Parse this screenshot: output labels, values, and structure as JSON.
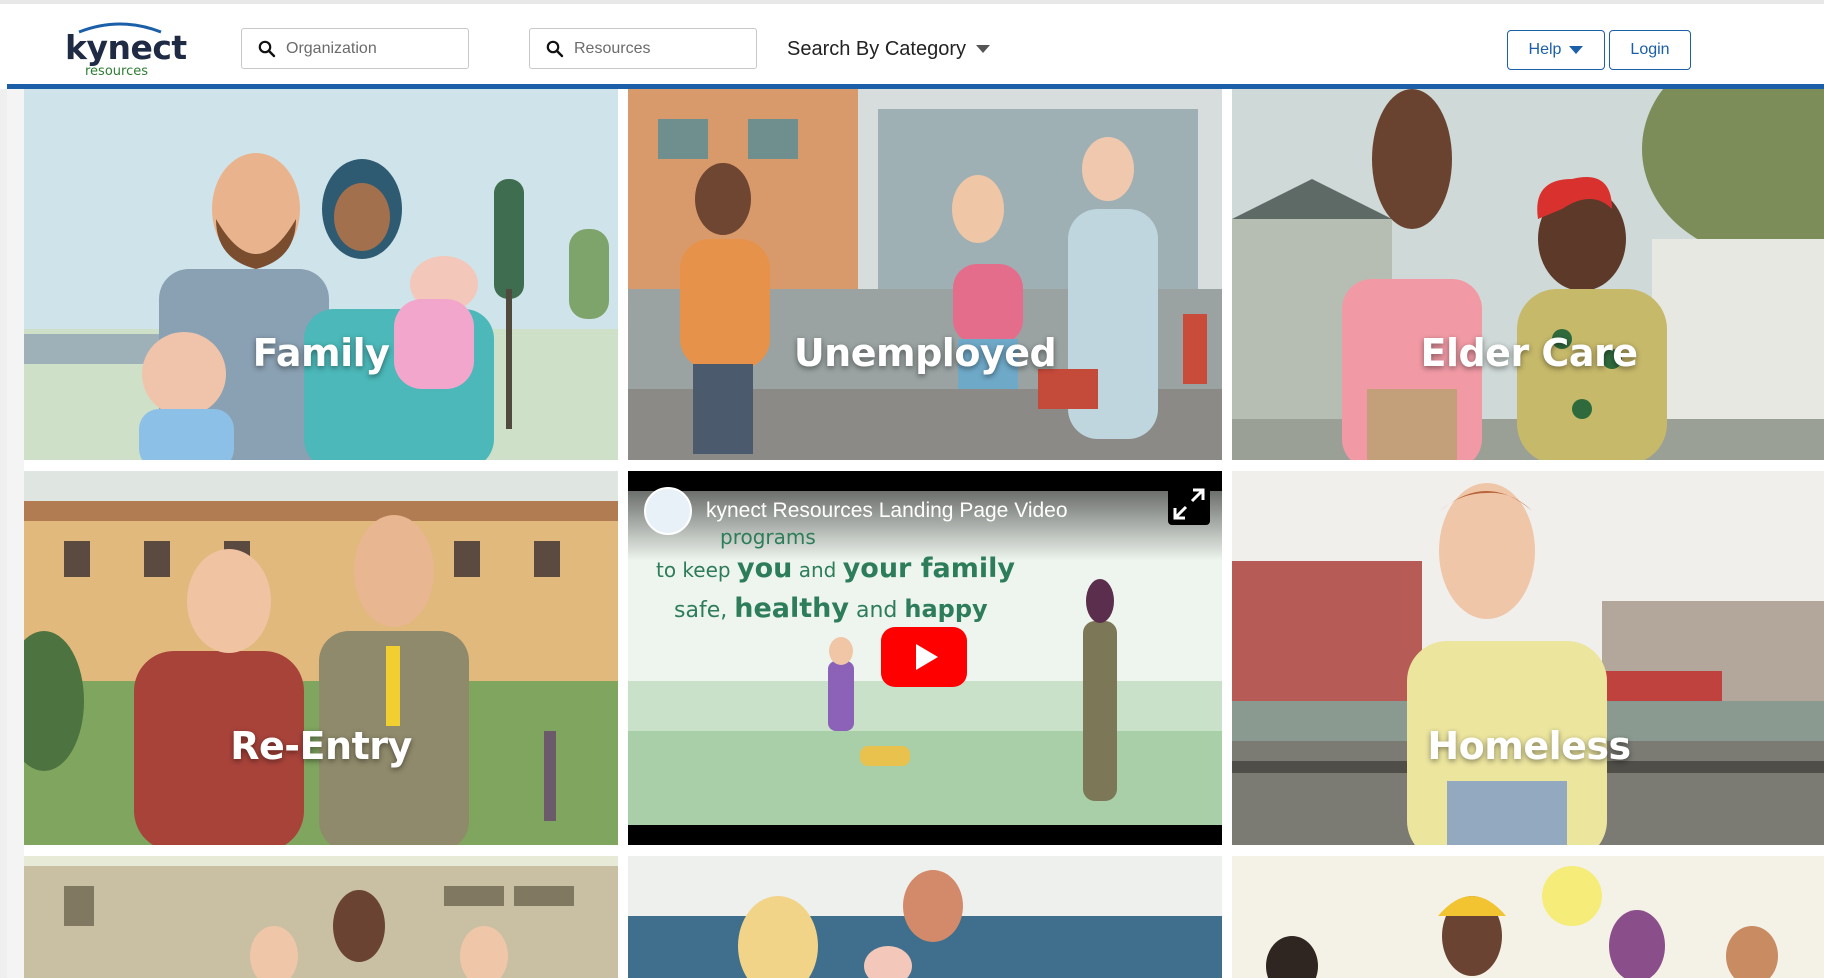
{
  "header": {
    "logo_word": "kynect",
    "logo_sub": "resources",
    "org_search_placeholder": "Organization",
    "res_search_placeholder": "Resources",
    "category_label": "Search By Category",
    "help_label": "Help",
    "login_label": "Login",
    "brand_color": "#1a5fa8"
  },
  "tiles": [
    {
      "label": "Family"
    },
    {
      "label": "Unemployed"
    },
    {
      "label": "Elder Care"
    },
    {
      "label": "Re-Entry"
    },
    {
      "label": "Homeless"
    }
  ],
  "video": {
    "title": "kynect Resources Landing Page Video",
    "line1": "programs",
    "line2a": "to keep ",
    "line2b": "you",
    "line2c": " and ",
    "line2d": "your family",
    "line3a": "safe, ",
    "line3b": "healthy",
    "line3c": " and ",
    "line3d": "happy",
    "icon_play": "play-icon",
    "icon_expand": "fullscreen-icon"
  }
}
